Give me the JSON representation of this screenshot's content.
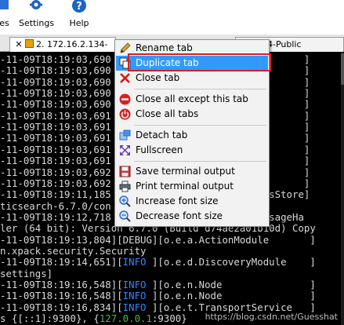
{
  "toolbar": {
    "items": [
      {
        "label": "ges",
        "icon": "sessions-icon"
      },
      {
        "label": "Settings",
        "icon": "gear-icon"
      },
      {
        "label": "Help",
        "icon": "help-icon"
      }
    ]
  },
  "tabs": [
    {
      "label": "2. 172.16.2.134-Public",
      "active": true
    },
    {
      "label": "4-Public",
      "active": false
    }
  ],
  "terminal": {
    "lines": [
      {
        "segments": [
          {
            "t": "-11-09T18:19:03,690",
            "c": "n"
          },
          {
            "t": "                      rvice      ]",
            "c": "n"
          }
        ]
      },
      {
        "segments": [
          {
            "t": "-11-09T18:19:03,690",
            "c": "n"
          },
          {
            "t": "                      rvice      ]",
            "c": "n"
          }
        ]
      },
      {
        "segments": [
          {
            "t": "-11-09T18:19:03,690",
            "c": "n"
          },
          {
            "t": "                      rvice      ]",
            "c": "n"
          }
        ]
      },
      {
        "segments": [
          {
            "t": "-11-09T18:19:03,690",
            "c": "n"
          },
          {
            "t": "                      rvice      ]",
            "c": "n"
          }
        ]
      },
      {
        "segments": [
          {
            "t": "-11-09T18:19:03,690",
            "c": "n"
          },
          {
            "t": "                      rvice      ]",
            "c": "n"
          }
        ]
      },
      {
        "segments": [
          {
            "t": "-11-09T18:19:03,691",
            "c": "n"
          },
          {
            "t": "                      rvice      ]",
            "c": "n"
          }
        ]
      },
      {
        "segments": [
          {
            "t": "-11-09T18:19:03,691",
            "c": "n"
          },
          {
            "t": "                      rvice      ]",
            "c": "n"
          }
        ]
      },
      {
        "segments": [
          {
            "t": "-11-09T18:19:03,691",
            "c": "n"
          },
          {
            "t": "                      rvice      ]",
            "c": "n"
          }
        ]
      },
      {
        "segments": [
          {
            "t": "-11-09T18:19:03,691",
            "c": "n"
          },
          {
            "t": "                      rvice      ]",
            "c": "n"
          }
        ]
      },
      {
        "segments": [
          {
            "t": "-11-09T18:19:03,691",
            "c": "n"
          },
          {
            "t": "                      rvice      ]",
            "c": "n"
          }
        ]
      },
      {
        "segments": [
          {
            "t": "-11-09T18:19:03,692",
            "c": "n"
          },
          {
            "t": "                      rvice      ]",
            "c": "n"
          }
        ]
      },
      {
        "segments": [
          {
            "t": "-11-09T18:19:03,692",
            "c": "n"
          },
          {
            "t": "                      rvice      ]",
            "c": "n"
          }
        ]
      },
      {
        "segments": [
          {
            "t": "-11-09T18:19:11,185",
            "c": "n"
          },
          {
            "t": "                      eRolesStore]",
            "c": "n"
          }
        ]
      },
      {
        "segments": [
          {
            "t": "ticsearch-6.7.0/con",
            "c": "n"
          }
        ]
      },
      {
        "segments": [
          {
            "t": "-11-09T18:19:12,718",
            "c": "n"
          },
          {
            "t": "                      ogMessageHa",
            "c": "n"
          }
        ]
      },
      {
        "segments": [
          {
            "t": "ler (64 bit): Version 6.7.0 (Build d74ae2a01b10d) Copy",
            "c": "n"
          }
        ]
      },
      {
        "segments": [
          {
            "t": "-11-09T18:19:13,804][DEBUG][o.e.a.ActionModule       ]",
            "c": "n"
          }
        ]
      },
      {
        "segments": [
          {
            "t": "n.xpack.security.Security",
            "c": "n"
          }
        ]
      },
      {
        "segments": [
          {
            "t": "-11-09T18:19:14,651][",
            "c": "n"
          },
          {
            "t": "INFO",
            "c": "c"
          },
          {
            "t": " ][o.e.d.DiscoveryModule    ]",
            "c": "n"
          }
        ]
      },
      {
        "segments": [
          {
            "t": "settings]",
            "c": "n"
          }
        ]
      },
      {
        "segments": [
          {
            "t": "-11-09T18:19:16,548][",
            "c": "n"
          },
          {
            "t": "INFO",
            "c": "c"
          },
          {
            "t": " ][o.e.n.Node               ]",
            "c": "n"
          }
        ]
      },
      {
        "segments": [
          {
            "t": "-11-09T18:19:16,548][",
            "c": "n"
          },
          {
            "t": "INFO",
            "c": "c"
          },
          {
            "t": " ][o.e.n.Node               ]",
            "c": "n"
          }
        ]
      },
      {
        "segments": [
          {
            "t": "-11-09T18:19:16,834][",
            "c": "n"
          },
          {
            "t": "INFO",
            "c": "c"
          },
          {
            "t": " ][o.e.t.TransportService   ]",
            "c": "n"
          }
        ]
      },
      {
        "segments": [
          {
            "t": "s {[::1]:9300}, {",
            "c": "n"
          },
          {
            "t": "127.0.0.1",
            "c": "g"
          },
          {
            "t": ":9300}",
            "c": "n"
          }
        ]
      }
    ]
  },
  "context_menu": {
    "items": [
      {
        "label": "Rename tab",
        "icon": "rename-pencil-icon"
      },
      {
        "label": "Duplicate tab",
        "icon": "duplicate-icon",
        "highlighted": true
      },
      {
        "label": "Close tab",
        "icon": "close-x-icon"
      },
      {
        "label": "Close all except this tab",
        "icon": "minus-circle-icon"
      },
      {
        "label": "Close all tabs",
        "icon": "power-icon"
      },
      {
        "label": "Detach tab",
        "icon": "detach-icon"
      },
      {
        "label": "Fullscreen",
        "icon": "fullscreen-icon"
      },
      {
        "label": "Save terminal output",
        "icon": "save-icon"
      },
      {
        "label": "Print terminal output",
        "icon": "printer-icon"
      },
      {
        "label": "Increase font size",
        "icon": "zoom-in-icon"
      },
      {
        "label": "Decrease font size",
        "icon": "zoom-out-icon"
      }
    ]
  },
  "watermark": "https://blog.csdn.net/Guesshat",
  "colors": {
    "menu_highlight": "#3399ff",
    "annotation_box": "#d91e1e",
    "info_blue": "#2f86ff",
    "ip_green": "#3fbf3f"
  }
}
